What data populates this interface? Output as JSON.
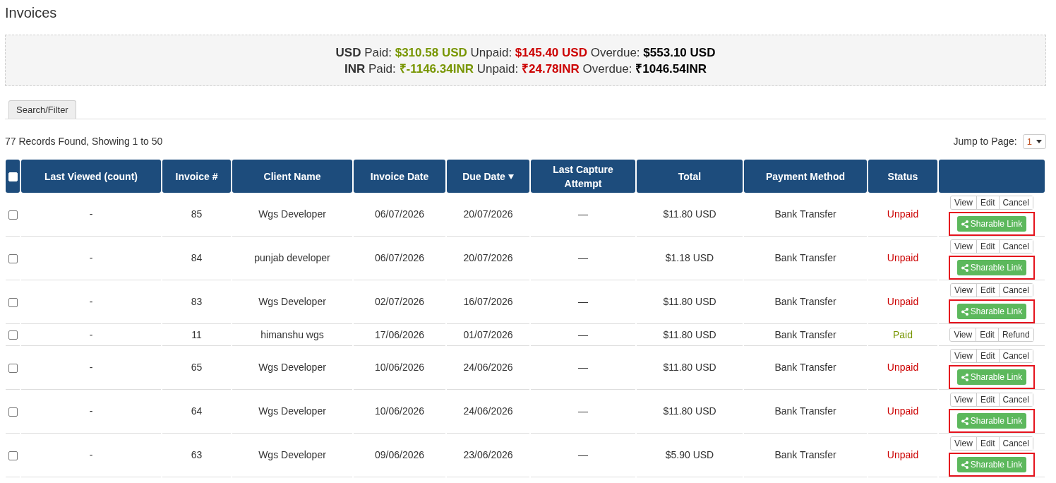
{
  "page": {
    "title": "Invoices"
  },
  "summary": [
    {
      "currency": "USD",
      "items": [
        {
          "label": "Paid:",
          "value": "$310.58 USD",
          "kind": "paid"
        },
        {
          "label": "Unpaid:",
          "value": "$145.40 USD",
          "kind": "unpaid"
        },
        {
          "label": "Overdue:",
          "value": "$553.10 USD",
          "kind": "overdue"
        }
      ]
    },
    {
      "currency": "INR",
      "items": [
        {
          "label": "Paid:",
          "value": "₹-1146.34INR",
          "kind": "paid"
        },
        {
          "label": "Unpaid:",
          "value": "₹24.78INR",
          "kind": "unpaid"
        },
        {
          "label": "Overdue:",
          "value": "₹1046.54INR",
          "kind": "overdue"
        }
      ]
    }
  ],
  "tabs": [
    {
      "label": "Search/Filter"
    }
  ],
  "records_info": "77 Records Found, Showing 1 to 50",
  "pagination": {
    "label": "Jump to Page:",
    "value": "1"
  },
  "table": {
    "select_all": {
      "checked": false
    },
    "columns": [
      {
        "label": "Last Viewed (count)",
        "sorted": false
      },
      {
        "label": "Invoice #",
        "sorted": false
      },
      {
        "label": "Client Name",
        "sorted": false
      },
      {
        "label": "Invoice Date",
        "sorted": false
      },
      {
        "label": "Due Date",
        "sorted": true
      },
      {
        "label": "Last Capture Attempt",
        "sorted": false
      },
      {
        "label": "Total",
        "sorted": false
      },
      {
        "label": "Payment Method",
        "sorted": false
      },
      {
        "label": "Status",
        "sorted": false
      }
    ],
    "rows": [
      {
        "checked": false,
        "last_viewed": "-",
        "invoice": "85",
        "client": "Wgs Developer",
        "invoice_date": "06/07/2026",
        "due_date": "20/07/2026",
        "last_capture": "—",
        "total": "$11.80 USD",
        "payment_method": "Bank Transfer",
        "status": {
          "label": "Unpaid",
          "kind": "unpaid"
        },
        "actions": [
          "View",
          "Edit",
          "Cancel"
        ],
        "share": {
          "label": "Sharable Link",
          "highlighted": true
        }
      },
      {
        "checked": false,
        "last_viewed": "-",
        "invoice": "84",
        "client": "punjab developer",
        "invoice_date": "06/07/2026",
        "due_date": "20/07/2026",
        "last_capture": "—",
        "total": "$1.18 USD",
        "payment_method": "Bank Transfer",
        "status": {
          "label": "Unpaid",
          "kind": "unpaid"
        },
        "actions": [
          "View",
          "Edit",
          "Cancel"
        ],
        "share": {
          "label": "Sharable Link",
          "highlighted": true
        }
      },
      {
        "checked": false,
        "last_viewed": "-",
        "invoice": "83",
        "client": "Wgs Developer",
        "invoice_date": "02/07/2026",
        "due_date": "16/07/2026",
        "last_capture": "—",
        "total": "$11.80 USD",
        "payment_method": "Bank Transfer",
        "status": {
          "label": "Unpaid",
          "kind": "unpaid"
        },
        "actions": [
          "View",
          "Edit",
          "Cancel"
        ],
        "share": {
          "label": "Sharable Link",
          "highlighted": true
        }
      },
      {
        "checked": false,
        "last_viewed": "-",
        "invoice": "11",
        "client": "himanshu wgs",
        "invoice_date": "17/06/2026",
        "due_date": "01/07/2026",
        "last_capture": "—",
        "total": "$11.80 USD",
        "payment_method": "Bank Transfer",
        "status": {
          "label": "Paid",
          "kind": "paid"
        },
        "actions": [
          "View",
          "Edit",
          "Refund"
        ]
      },
      {
        "checked": false,
        "last_viewed": "-",
        "invoice": "65",
        "client": "Wgs Developer",
        "invoice_date": "10/06/2026",
        "due_date": "24/06/2026",
        "last_capture": "—",
        "total": "$11.80 USD",
        "payment_method": "Bank Transfer",
        "status": {
          "label": "Unpaid",
          "kind": "unpaid"
        },
        "actions": [
          "View",
          "Edit",
          "Cancel"
        ],
        "share": {
          "label": "Sharable Link",
          "highlighted": true
        }
      },
      {
        "checked": false,
        "last_viewed": "-",
        "invoice": "64",
        "client": "Wgs Developer",
        "invoice_date": "10/06/2026",
        "due_date": "24/06/2026",
        "last_capture": "—",
        "total": "$11.80 USD",
        "payment_method": "Bank Transfer",
        "status": {
          "label": "Unpaid",
          "kind": "unpaid"
        },
        "actions": [
          "View",
          "Edit",
          "Cancel"
        ],
        "share": {
          "label": "Sharable Link",
          "highlighted": true
        }
      },
      {
        "checked": false,
        "last_viewed": "-",
        "invoice": "63",
        "client": "Wgs Developer",
        "invoice_date": "09/06/2026",
        "due_date": "23/06/2026",
        "last_capture": "—",
        "total": "$5.90 USD",
        "payment_method": "Bank Transfer",
        "status": {
          "label": "Unpaid",
          "kind": "unpaid"
        },
        "actions": [
          "View",
          "Edit",
          "Cancel"
        ],
        "share": {
          "label": "Sharable Link",
          "highlighted": true
        }
      }
    ]
  }
}
